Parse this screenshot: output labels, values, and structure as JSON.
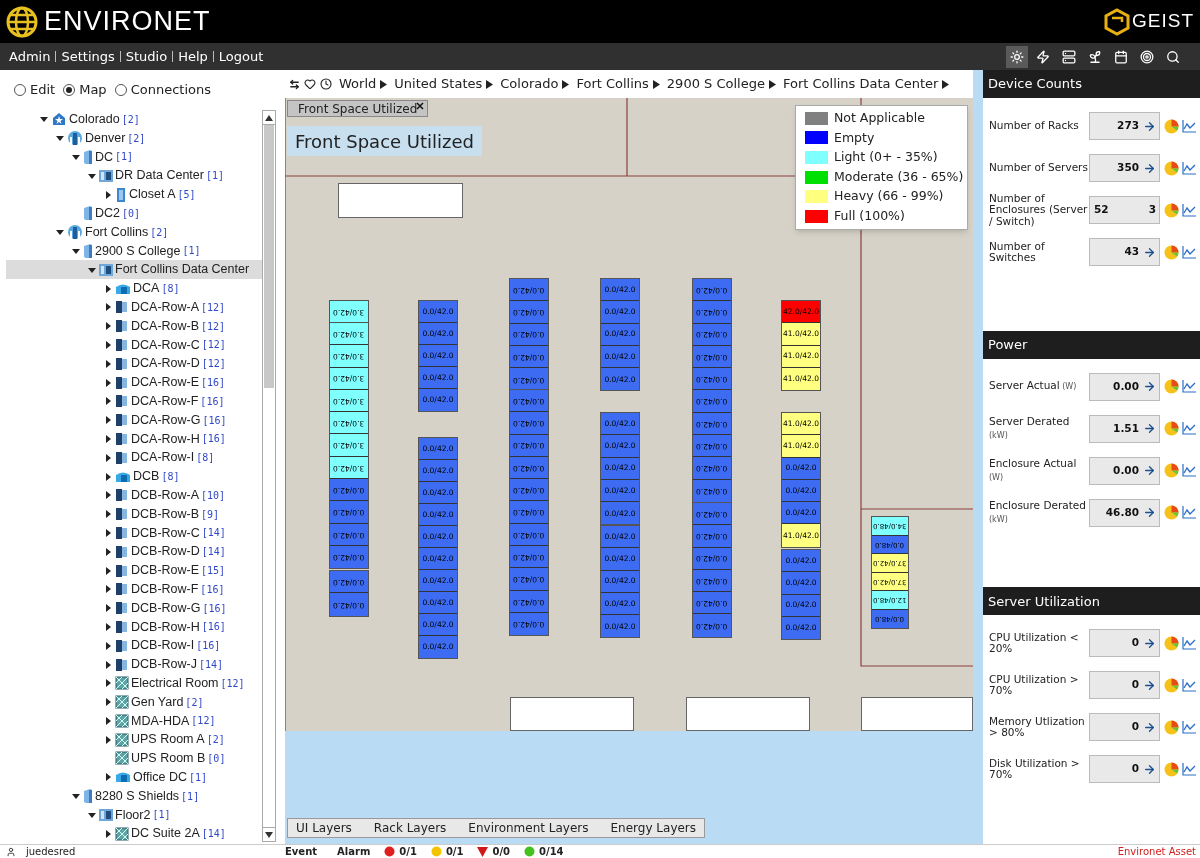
{
  "header": {
    "logo": "ENVIRONET",
    "brand": "GEIST"
  },
  "menu": [
    "Admin",
    "Settings",
    "Studio",
    "Help",
    "Logout"
  ],
  "toolbar": [
    {
      "selected": true
    },
    {
      "selected": false
    },
    {
      "selected": false
    },
    {
      "selected": false
    },
    {
      "selected": false
    },
    {
      "selected": false
    },
    {
      "selected": false
    }
  ],
  "view_modes": [
    {
      "label": "Edit",
      "selected": false
    },
    {
      "label": "Map",
      "selected": true
    },
    {
      "label": "Connections",
      "selected": false
    }
  ],
  "tree": [
    {
      "label": "Colorado",
      "count": "[2]",
      "kind": "region",
      "expanded": true,
      "selected": false,
      "children": [
        {
          "label": "Denver",
          "count": "[2]",
          "kind": "city",
          "expanded": true,
          "selected": false,
          "children": [
            {
              "label": "DC",
              "count": "[1]",
              "kind": "building",
              "expanded": true,
              "selected": false,
              "children": [
                {
                  "label": "DR Data Center",
                  "count": "[1]",
                  "kind": "datacenter",
                  "expanded": true,
                  "selected": false,
                  "children": [
                    {
                      "label": "Closet A",
                      "count": "[5]",
                      "kind": "closet",
                      "expanded": false,
                      "selected": false
                    }
                  ]
                }
              ]
            },
            {
              "label": "DC2",
              "count": "[0]",
              "kind": "building",
              "selected": false
            }
          ]
        },
        {
          "label": "Fort Collins",
          "count": "[2]",
          "kind": "city",
          "expanded": true,
          "selected": false,
          "children": [
            {
              "label": "2900 S College",
              "count": "[1]",
              "kind": "building",
              "expanded": true,
              "selected": false,
              "children": [
                {
                  "label": "Fort Collins Data Center",
                  "kind": "datacenter",
                  "expanded": true,
                  "selected": true,
                  "children": [
                    {
                      "label": "DCA",
                      "count": "[8]",
                      "kind": "zone",
                      "expanded": false,
                      "selected": false
                    },
                    {
                      "label": "DCA-Row-A",
                      "count": "[12]",
                      "kind": "row",
                      "expanded": false,
                      "selected": false
                    },
                    {
                      "label": "DCA-Row-B",
                      "count": "[12]",
                      "kind": "row",
                      "expanded": false,
                      "selected": false
                    },
                    {
                      "label": "DCA-Row-C",
                      "count": "[12]",
                      "kind": "row",
                      "expanded": false,
                      "selected": false
                    },
                    {
                      "label": "DCA-Row-D",
                      "count": "[12]",
                      "kind": "row",
                      "expanded": false,
                      "selected": false
                    },
                    {
                      "label": "DCA-Row-E",
                      "count": "[16]",
                      "kind": "row",
                      "expanded": false,
                      "selected": false
                    },
                    {
                      "label": "DCA-Row-F",
                      "count": "[16]",
                      "kind": "row",
                      "expanded": false,
                      "selected": false
                    },
                    {
                      "label": "DCA-Row-G",
                      "count": "[16]",
                      "kind": "row",
                      "expanded": false,
                      "selected": false
                    },
                    {
                      "label": "DCA-Row-H",
                      "count": "[16]",
                      "kind": "row",
                      "expanded": false,
                      "selected": false
                    },
                    {
                      "label": "DCA-Row-I",
                      "count": "[8]",
                      "kind": "row",
                      "expanded": false,
                      "selected": false
                    },
                    {
                      "label": "DCB",
                      "count": "[8]",
                      "kind": "zone",
                      "expanded": false,
                      "selected": false
                    },
                    {
                      "label": "DCB-Row-A",
                      "count": "[10]",
                      "kind": "row",
                      "expanded": false,
                      "selected": false
                    },
                    {
                      "label": "DCB-Row-B",
                      "count": "[9]",
                      "kind": "row",
                      "expanded": false,
                      "selected": false
                    },
                    {
                      "label": "DCB-Row-C",
                      "count": "[14]",
                      "kind": "row",
                      "expanded": false,
                      "selected": false
                    },
                    {
                      "label": "DCB-Row-D",
                      "count": "[14]",
                      "kind": "row",
                      "expanded": false,
                      "selected": false
                    },
                    {
                      "label": "DCB-Row-E",
                      "count": "[15]",
                      "kind": "row",
                      "expanded": false,
                      "selected": false
                    },
                    {
                      "label": "DCB-Row-F",
                      "count": "[16]",
                      "kind": "row",
                      "expanded": false,
                      "selected": false
                    },
                    {
                      "label": "DCB-Row-G",
                      "count": "[16]",
                      "kind": "row",
                      "expanded": false,
                      "selected": false
                    },
                    {
                      "label": "DCB-Row-H",
                      "count": "[16]",
                      "kind": "row",
                      "expanded": false,
                      "selected": false
                    },
                    {
                      "label": "DCB-Row-I",
                      "count": "[16]",
                      "kind": "row",
                      "expanded": false,
                      "selected": false
                    },
                    {
                      "label": "DCB-Row-J",
                      "count": "[14]",
                      "kind": "row",
                      "expanded": false,
                      "selected": false
                    },
                    {
                      "label": "Electrical Room",
                      "count": "[12]",
                      "kind": "room",
                      "expanded": false,
                      "selected": false
                    },
                    {
                      "label": "Gen Yard",
                      "count": "[2]",
                      "kind": "room",
                      "expanded": false,
                      "selected": false
                    },
                    {
                      "label": "MDA-HDA",
                      "count": "[12]",
                      "kind": "room",
                      "expanded": false,
                      "selected": false
                    },
                    {
                      "label": "UPS Room A",
                      "count": "[2]",
                      "kind": "room",
                      "expanded": false,
                      "selected": false
                    },
                    {
                      "label": "UPS Room B",
                      "count": "[0]",
                      "kind": "room",
                      "selected": false
                    },
                    {
                      "label": "Office DC",
                      "count": "[1]",
                      "kind": "zone",
                      "expanded": false,
                      "selected": false
                    }
                  ]
                }
              ]
            },
            {
              "label": "8280 S Shields",
              "count": "[1]",
              "kind": "building",
              "expanded": true,
              "selected": false,
              "children": [
                {
                  "label": "Floor2",
                  "count": "[1]",
                  "kind": "datacenter",
                  "expanded": true,
                  "selected": false,
                  "children": [
                    {
                      "label": "DC Suite 2A",
                      "count": "[14]",
                      "kind": "room",
                      "expanded": false,
                      "selected": false
                    }
                  ]
                }
              ]
            }
          ]
        }
      ]
    }
  ],
  "breadcrumb": [
    "World",
    "United States",
    "Colorado",
    "Fort Collins",
    "2900 S College",
    "Fort Collins Data Center"
  ],
  "map": {
    "tab": "Front Space Utilized",
    "title": "Front Space Utilized",
    "legend": [
      {
        "label": "Not Applicable",
        "color": "#808080"
      },
      {
        "label": "Empty",
        "color": "#0000ff"
      },
      {
        "label": "Light (0+ - 35%)",
        "color": "#80ffff"
      },
      {
        "label": "Moderate (36 - 65%)",
        "color": "#00e000"
      },
      {
        "label": "Heavy (66 - 99%)",
        "color": "#ffff80"
      },
      {
        "label": "Full (100%)",
        "color": "#ff0000"
      }
    ],
    "rack_columns": [
      {
        "flipped": true,
        "groups": [
          [
            {
              "label": "3.0/42.0",
              "color": "#80ffff"
            }
          ],
          [
            {
              "label": "3.0/42.0",
              "color": "#80ffff"
            },
            {
              "label": "3.0/42.0",
              "color": "#80ffff"
            },
            {
              "label": "3.0/42.0",
              "color": "#80ffff"
            },
            {
              "label": "3.0/42.0",
              "color": "#80ffff"
            },
            {
              "label": "3.0/42.0",
              "color": "#80ffff"
            },
            {
              "label": "3.0/42.0",
              "color": "#80ffff"
            },
            {
              "label": "3.0/42.0",
              "color": "#80ffff"
            },
            {
              "label": "0.0/42.0",
              "color": "#3d6cf2"
            },
            {
              "label": "0.0/42.0",
              "color": "#3d6cf2"
            },
            {
              "label": "0.0/42.0",
              "color": "#3d6cf2"
            },
            {
              "label": "0.0/42.0",
              "color": "#3d6cf2"
            }
          ],
          [
            {
              "label": "0.0/42.0",
              "color": "#3d6cf2"
            },
            {
              "label": "0.0/42.0",
              "color": "#3d6cf2"
            }
          ]
        ]
      },
      {
        "flipped": false,
        "groups": [
          [
            {
              "label": "0.0/42.0",
              "color": "#3d6cf2"
            },
            {
              "label": "0.0/42.0",
              "color": "#3d6cf2"
            },
            {
              "label": "0.0/42.0",
              "color": "#3d6cf2"
            },
            {
              "label": "0.0/42.0",
              "color": "#3d6cf2"
            },
            {
              "label": "0.0/42.0",
              "color": "#3d6cf2"
            }
          ],
          [
            {
              "label": "0.0/42.0",
              "color": "#3d6cf2"
            },
            {
              "label": "0.0/42.0",
              "color": "#3d6cf2"
            },
            {
              "label": "0.0/42.0",
              "color": "#3d6cf2"
            },
            {
              "label": "0.0/42.0",
              "color": "#3d6cf2"
            },
            {
              "label": "0.0/42.0",
              "color": "#3d6cf2"
            },
            {
              "label": "0.0/42.0",
              "color": "#3d6cf2"
            },
            {
              "label": "0.0/42.0",
              "color": "#3d6cf2"
            },
            {
              "label": "0.0/42.0",
              "color": "#3d6cf2"
            },
            {
              "label": "0.0/42.0",
              "color": "#3d6cf2"
            },
            {
              "label": "0.0/42.0",
              "color": "#3d6cf2"
            }
          ]
        ]
      },
      {
        "flipped": true,
        "groups": [
          [
            {
              "label": "0.0/42.0",
              "color": "#3d6cf2"
            },
            {
              "label": "0.0/42.0",
              "color": "#3d6cf2"
            },
            {
              "label": "0.0/42.0",
              "color": "#3d6cf2"
            },
            {
              "label": "0.0/42.0",
              "color": "#3d6cf2"
            },
            {
              "label": "0.0/42.0",
              "color": "#3d6cf2"
            }
          ],
          [
            {
              "label": "0.0/42.0",
              "color": "#3d6cf2"
            },
            {
              "label": "0.0/42.0",
              "color": "#3d6cf2"
            },
            {
              "label": "0.0/42.0",
              "color": "#3d6cf2"
            },
            {
              "label": "0.0/42.0",
              "color": "#3d6cf2"
            },
            {
              "label": "0.0/42.0",
              "color": "#3d6cf2"
            },
            {
              "label": "0.0/42.0",
              "color": "#3d6cf2"
            },
            {
              "label": "0.0/42.0",
              "color": "#3d6cf2"
            },
            {
              "label": "0.0/42.0",
              "color": "#3d6cf2"
            },
            {
              "label": "0.0/42.0",
              "color": "#3d6cf2"
            },
            {
              "label": "0.0/42.0",
              "color": "#3d6cf2"
            },
            {
              "label": "0.0/42.0",
              "color": "#3d6cf2"
            }
          ]
        ]
      },
      {
        "flipped": false,
        "groups": [
          [
            {
              "label": "0.0/42.0",
              "color": "#3d6cf2"
            },
            {
              "label": "0.0/42.0",
              "color": "#3d6cf2"
            },
            {
              "label": "0.0/42.0",
              "color": "#3d6cf2"
            },
            {
              "label": "0.0/42.0",
              "color": "#3d6cf2"
            },
            {
              "label": "0.0/42.0",
              "color": "#3d6cf2"
            }
          ],
          [
            {
              "label": "0.0/42.0",
              "color": "#3d6cf2"
            },
            {
              "label": "0.0/42.0",
              "color": "#3d6cf2"
            },
            {
              "label": "0.0/42.0",
              "color": "#3d6cf2"
            },
            {
              "label": "0.0/42.0",
              "color": "#3d6cf2"
            },
            {
              "label": "0.0/42.0",
              "color": "#3d6cf2"
            }
          ],
          [
            {
              "label": "0.0/42.0",
              "color": "#3d6cf2"
            },
            {
              "label": "0.0/42.0",
              "color": "#3d6cf2"
            },
            {
              "label": "0.0/42.0",
              "color": "#3d6cf2"
            },
            {
              "label": "0.0/42.0",
              "color": "#3d6cf2"
            },
            {
              "label": "0.0/42.0",
              "color": "#3d6cf2"
            }
          ]
        ]
      },
      {
        "flipped": true,
        "groups": [
          [
            {
              "label": "0.0/42.0",
              "color": "#3d6cf2"
            },
            {
              "label": "0.0/42.0",
              "color": "#3d6cf2"
            },
            {
              "label": "0.0/42.0",
              "color": "#3d6cf2"
            },
            {
              "label": "0.0/42.0",
              "color": "#3d6cf2"
            },
            {
              "label": "0.0/42.0",
              "color": "#3d6cf2"
            },
            {
              "label": "0.0/42.0",
              "color": "#3d6cf2"
            },
            {
              "label": "0.0/42.0",
              "color": "#3d6cf2"
            },
            {
              "label": "0.0/42.0",
              "color": "#3d6cf2"
            },
            {
              "label": "0.0/42.0",
              "color": "#3d6cf2"
            },
            {
              "label": "0.0/42.0",
              "color": "#3d6cf2"
            }
          ],
          [
            {
              "label": "0.0/42.0",
              "color": "#3d6cf2"
            },
            {
              "label": "0.0/42.0",
              "color": "#3d6cf2"
            },
            {
              "label": "0.0/42.0",
              "color": "#3d6cf2"
            },
            {
              "label": "0.0/42.0",
              "color": "#3d6cf2"
            },
            {
              "label": "0.0/42.0",
              "color": "#3d6cf2"
            },
            {
              "label": "0.0/42.0",
              "color": "#3d6cf2"
            }
          ]
        ]
      },
      {
        "flipped": false,
        "groups": [
          [
            {
              "label": "42.0/42.0",
              "color": "#ff0000"
            },
            {
              "label": "41.0/42.0",
              "color": "#ffff80"
            },
            {
              "label": "41.0/42.0",
              "color": "#ffff80"
            },
            {
              "label": "41.0/42.0",
              "color": "#ffff80"
            }
          ],
          [
            {
              "label": "41.0/42.0",
              "color": "#ffff80"
            },
            {
              "label": "41.0/42.0",
              "color": "#ffff80"
            },
            {
              "label": "0.0/42.0",
              "color": "#3d6cf2"
            },
            {
              "label": "0.0/42.0",
              "color": "#3d6cf2"
            },
            {
              "label": "0.0/42.0",
              "color": "#3d6cf2"
            },
            {
              "label": "41.0/42.0",
              "color": "#ffff80"
            }
          ],
          [
            {
              "label": "0.0/42.0",
              "color": "#3d6cf2"
            },
            {
              "label": "0.0/42.0",
              "color": "#3d6cf2"
            },
            {
              "label": "0.0/42.0",
              "color": "#3d6cf2"
            },
            {
              "label": "0.0/42.0",
              "color": "#3d6cf2"
            }
          ]
        ]
      },
      {
        "flipped": true,
        "groups": [
          [
            {
              "label": "34.0/48.0",
              "color": "#80ffff"
            },
            {
              "label": "0.0/48.0",
              "color": "#3d6cf2"
            },
            {
              "label": "37.0/42.0",
              "color": "#ffff80"
            },
            {
              "label": "37.0/42.0",
              "color": "#ffff80"
            },
            {
              "label": "12.0/48.0",
              "color": "#80ffff"
            },
            {
              "label": "0.0/48.0",
              "color": "#3d6cf2"
            }
          ]
        ]
      }
    ],
    "layers": [
      "UI Layers",
      "Rack Layers",
      "Environment Layers",
      "Energy Layers"
    ]
  },
  "panels": [
    {
      "title": "Device Counts",
      "rows": [
        {
          "label": "Number of Racks",
          "values": [
            "273"
          ]
        },
        {
          "label": "Number of Servers",
          "values": [
            "350"
          ]
        },
        {
          "label": "Number of Enclosures (Server / Switch)",
          "values": [
            "52",
            "3"
          ]
        },
        {
          "label": "Number of Switches",
          "values": [
            "43"
          ]
        }
      ]
    },
    {
      "title": "Power",
      "rows": [
        {
          "label": "Server Actual",
          "unit": "(W)",
          "values": [
            "0.00"
          ]
        },
        {
          "label": "Server Derated",
          "unit": "(kW)",
          "values": [
            "1.51"
          ]
        },
        {
          "label": "Enclosure Actual",
          "unit": "(W)",
          "values": [
            "0.00"
          ]
        },
        {
          "label": "Enclosure Derated",
          "unit": "(kW)",
          "values": [
            "46.80"
          ]
        }
      ]
    },
    {
      "title": "Server Utilization",
      "rows": [
        {
          "label": "CPU Utilization < 20%",
          "values": [
            "0"
          ]
        },
        {
          "label": "CPU Utilization > 70%",
          "values": [
            "0"
          ]
        },
        {
          "label": "Memory Utlization > 80%",
          "values": [
            "0"
          ]
        },
        {
          "label": "Disk Utilization > 70%",
          "values": [
            "0"
          ]
        }
      ]
    }
  ],
  "status_bar": {
    "user": "juedesred",
    "event": "Event",
    "alarm": "Alarm",
    "counts": [
      {
        "kind": "critical",
        "text": "0/1"
      },
      {
        "kind": "warning",
        "text": "0/1"
      },
      {
        "kind": "down",
        "text": "0/0"
      },
      {
        "kind": "ok",
        "text": "0/14"
      }
    ],
    "link": "Environet Asset"
  }
}
